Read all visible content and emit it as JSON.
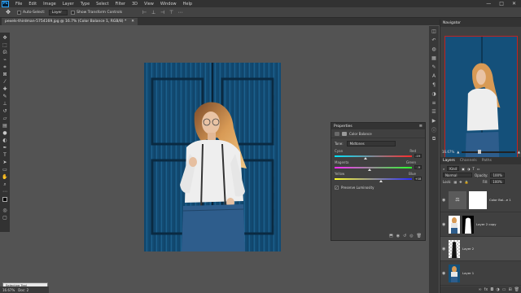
{
  "menubar": {
    "logo": "Ps",
    "items": [
      "File",
      "Edit",
      "Image",
      "Layer",
      "Type",
      "Select",
      "Filter",
      "3D",
      "View",
      "Window",
      "Help"
    ],
    "window_controls": [
      "—",
      "□",
      "✕"
    ]
  },
  "options": {
    "auto_select_label": "Auto-Select:",
    "layer_select_value": "Layer",
    "show_transform_label": "Show Transform Controls"
  },
  "document": {
    "tab_title": "pexels-thirdman-5754169.jpg @ 16.7% (Color Balance 1, RGB/8) *",
    "close_glyph": "✕"
  },
  "properties": {
    "tab_label": "Properties",
    "adjustment_title": "Color Balance",
    "tone_label": "Tone:",
    "tone_value": "Midtones",
    "sliders": [
      {
        "left": "Cyan",
        "right": "Red",
        "value": "-19",
        "position": 0.4,
        "color_left": "#00e5ff",
        "color_right": "#ff2a2a"
      },
      {
        "left": "Magenta",
        "right": "Green",
        "value": "-9",
        "position": 0.45,
        "color_left": "#ff2aff",
        "color_right": "#2aff2a"
      },
      {
        "left": "Yellow",
        "right": "Blue",
        "value": "+18",
        "position": 0.6,
        "color_left": "#ffff2a",
        "color_right": "#2a2aff"
      }
    ],
    "preserve_luminosity_label": "Preserve Luminosity"
  },
  "navigator": {
    "tab_label": "Navigator",
    "zoom_value": "16.67%"
  },
  "layers": {
    "tabs": [
      "Layers",
      "Channels",
      "Paths"
    ],
    "filter_label": "Kind",
    "blend_mode": "Normal",
    "opacity_label": "Opacity:",
    "opacity_value": "100%",
    "lock_label": "Lock:",
    "fill_label": "Fill:",
    "fill_value": "100%",
    "items": [
      {
        "name": "Color Bal...e 1",
        "type": "adjustment"
      },
      {
        "name": "Layer 2 copy",
        "type": "masked"
      },
      {
        "name": "Layer 2",
        "type": "cutout"
      },
      {
        "name": "Layer 1",
        "type": "photo"
      }
    ]
  },
  "tooltip": {
    "label": "Selective Tool"
  },
  "status": {
    "zoom": "16.67%",
    "doc_label": "Doc: 2"
  }
}
